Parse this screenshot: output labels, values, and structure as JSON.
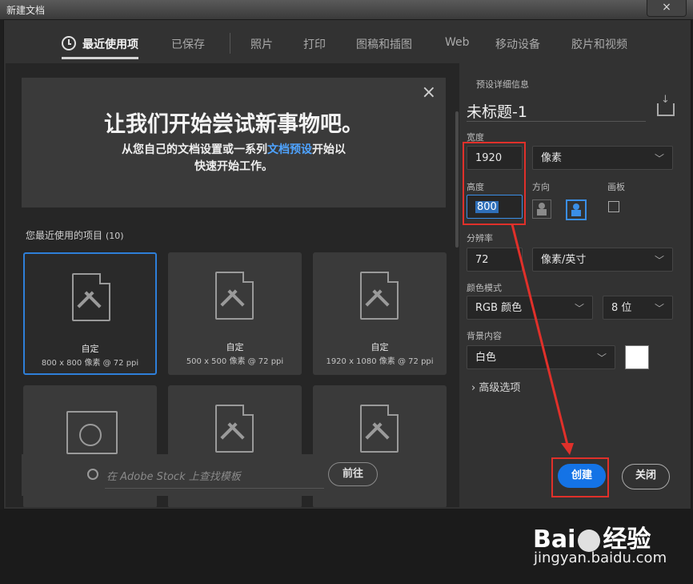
{
  "window": {
    "title": "新建文档",
    "close_icon": "×"
  },
  "tabs": [
    {
      "label": "最近使用项",
      "active": true
    },
    {
      "label": "已保存"
    },
    {
      "label": "照片"
    },
    {
      "label": "打印"
    },
    {
      "label": "图稿和插图"
    },
    {
      "label": "Web"
    },
    {
      "label": "移动设备"
    },
    {
      "label": "胶片和视频"
    }
  ],
  "welcome": {
    "title": "让我们开始尝试新事物吧。",
    "sub_before": "从您自己的文档设置或一系列",
    "sub_link": "文档预设",
    "sub_after": "开始以",
    "sub_line2": "快速开始工作。",
    "close": "×"
  },
  "recent": {
    "label": "您最近使用的项目",
    "count": "(10)"
  },
  "cards": [
    {
      "name": "自定",
      "info": "800 x 800 像素 @ 72 ppi"
    },
    {
      "name": "自定",
      "info": "500 x 500 像素 @ 72 ppi"
    },
    {
      "name": "自定",
      "info": "1920 x 1080 像素 @ 72 ppi"
    }
  ],
  "search": {
    "placeholder": "在 Adobe Stock 上查找模板",
    "go": "前往"
  },
  "preset": {
    "header": "预设详细信息",
    "name": "未标题-1",
    "width_label": "宽度",
    "width": "1920",
    "width_unit": "像素",
    "height_label": "高度",
    "height": "800",
    "orientation_label": "方向",
    "artboard_label": "画板",
    "resolution_label": "分辨率",
    "resolution": "72",
    "resolution_unit": "像素/英寸",
    "color_mode_label": "颜色模式",
    "color_mode": "RGB 颜色",
    "bit_depth": "8 位",
    "background_label": "背景内容",
    "background": "白色",
    "background_color": "#ffffff",
    "advanced": "高级选项",
    "create": "创建",
    "close": "关闭"
  },
  "watermark": {
    "brand_a": "Bai",
    "brand_b": "经验",
    "url": "jingyan.baidu.com"
  },
  "colors": {
    "accent": "#1473e6",
    "annotation": "#e0302a"
  }
}
